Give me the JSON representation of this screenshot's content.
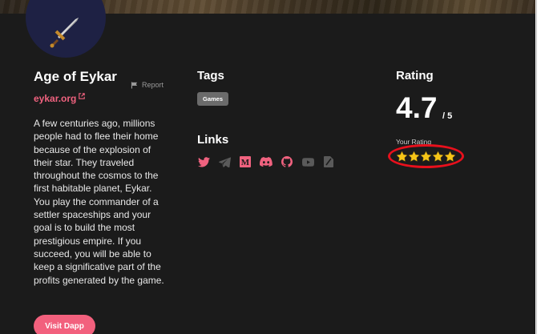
{
  "project": {
    "title": "Age of Eykar",
    "report_label": "Report",
    "website_label": "eykar.org",
    "description": "A few centuries ago, millions people had to flee their home because of the explosion of their star. They traveled throughout the cosmos to the first habitable planet, Eykar. You play the commander of a settler spaceships and your goal is to build the most prestigious empire. If you succeed, you will be able to keep a significative part of the profits generated by the game.",
    "visit_button_label": "Visit Dapp",
    "logo_icon": "sword-icon"
  },
  "tags": {
    "heading": "Tags",
    "items": [
      "Games"
    ]
  },
  "links": {
    "heading": "Links",
    "icons": [
      {
        "name": "twitter-icon",
        "color": "#f0627f"
      },
      {
        "name": "telegram-icon",
        "color": "#5a5a5a"
      },
      {
        "name": "medium-icon",
        "color": "#f0627f"
      },
      {
        "name": "discord-icon",
        "color": "#f0627f"
      },
      {
        "name": "github-icon",
        "color": "#f0627f"
      },
      {
        "name": "youtube-icon",
        "color": "#5a5a5a"
      },
      {
        "name": "document-icon",
        "color": "#5a5a5a"
      }
    ]
  },
  "rating": {
    "heading": "Rating",
    "value": "4.7",
    "max_label": "/ 5",
    "your_rating_label": "Your Rating",
    "your_rating_stars": 5,
    "star_color": "#f5c518"
  },
  "colors": {
    "accent": "#f0627f",
    "background": "#1b1b1b",
    "annotation": "#e8101c"
  }
}
